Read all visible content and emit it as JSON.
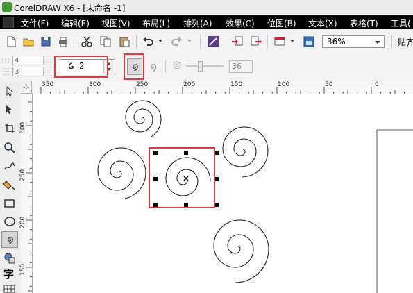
{
  "window": {
    "title": "CorelDRAW X6 - [未命名 -1]"
  },
  "menu": {
    "items": [
      "文件(F)",
      "编辑(E)",
      "视图(V)",
      "布局(L)",
      "排列(A)",
      "效果(C)",
      "位图(B)",
      "文本(X)",
      "表格(T)",
      "工具("
    ]
  },
  "toolbar": {
    "zoom_value": "36%",
    "snap_label": "贴齐"
  },
  "property_bar": {
    "field_a": "4",
    "field_b": "3",
    "revolutions": "2",
    "expansion_value": "36"
  },
  "ruler": {
    "horizontal_ticks": [
      "350",
      "300",
      "250",
      "200",
      "150",
      "100",
      "50",
      "0"
    ],
    "vertical_ticks": [
      "300",
      "250",
      "200",
      "150"
    ]
  },
  "toolbox": {
    "text_tool_glyph": "字"
  },
  "colors": {
    "highlight": "#e0393e",
    "menu_bg": "#000000"
  },
  "canvas": {
    "objects": [
      "spiral",
      "spiral",
      "spiral",
      "spiral",
      "spiral (selected)"
    ]
  }
}
